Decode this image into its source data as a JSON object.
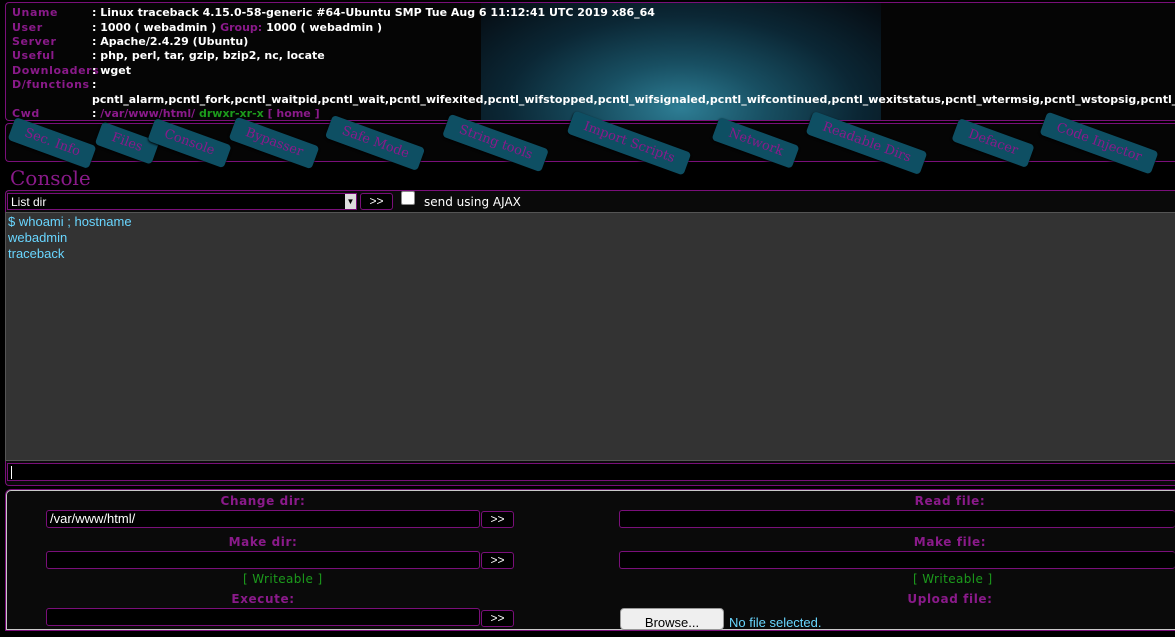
{
  "header": {
    "rows": [
      {
        "key": "Uname",
        "value": ": Linux traceback 4.15.0-58-generic #64-Ubuntu SMP Tue Aug 6 11:12:41 UTC 2019 x86_64"
      },
      {
        "key": "User",
        "value_pre": ": 1000 ( webadmin )",
        "group_key": "Group:",
        "value_post": "1000 ( webadmin )"
      },
      {
        "key": "Server",
        "value": ": Apache/2.4.29 (Ubuntu)"
      },
      {
        "key": "Useful",
        "value": ": php, perl, tar, gzip, bzip2, nc, locate"
      },
      {
        "key": "Downloaders",
        "value": ": wget"
      },
      {
        "key": "D/functions",
        "value": ":"
      },
      {
        "key": "Cwd",
        "value_colon": ":",
        "path": "/var/www/html/",
        "perms": "drwxr-xr-x",
        "home": "[ home ]"
      }
    ],
    "disabled_functions": "pcntl_alarm,pcntl_fork,pcntl_waitpid,pcntl_wait,pcntl_wifexited,pcntl_wifstopped,pcntl_wifsignaled,pcntl_wifcontinued,pcntl_wexitstatus,pcntl_wtermsig,pcntl_wstopsig,pcntl_s"
  },
  "nav": {
    "tabs": [
      {
        "label": "Sec. Info"
      },
      {
        "label": "Files"
      },
      {
        "label": "Console"
      },
      {
        "label": "Bypasser"
      },
      {
        "label": "Safe Mode"
      },
      {
        "label": "String tools"
      },
      {
        "label": "Import Scripts"
      },
      {
        "label": "Network"
      },
      {
        "label": "Readable Dirs"
      },
      {
        "label": "Defacer"
      },
      {
        "label": "Code Injector"
      }
    ]
  },
  "console": {
    "title": "Console",
    "select_value": "List dir",
    "go_label": ">>",
    "ajax_label": "send using AJAX",
    "output_lines": [
      "$ whoami ; hostname",
      "webadmin",
      "traceback"
    ]
  },
  "tools": {
    "change_dir": {
      "label": "Change dir:",
      "value": "/var/www/html/",
      "go": ">>"
    },
    "read_file": {
      "label": "Read file:"
    },
    "make_dir": {
      "label": "Make dir:",
      "go": ">>",
      "status": "[ Writeable ]"
    },
    "make_file": {
      "label": "Make file:",
      "status": "[ Writeable ]"
    },
    "execute": {
      "label": "Execute:",
      "go": ">>"
    },
    "upload_file": {
      "label": "Upload file:",
      "browse": "Browse...",
      "no_file": "No file selected."
    }
  },
  "colors": {
    "accent_purple": "#8a1a8a",
    "border_purple": "#7a0f7a",
    "tab_teal": "#0e4f63",
    "output_text": "#69d6ff",
    "writeable_green": "#1c9a1c"
  }
}
